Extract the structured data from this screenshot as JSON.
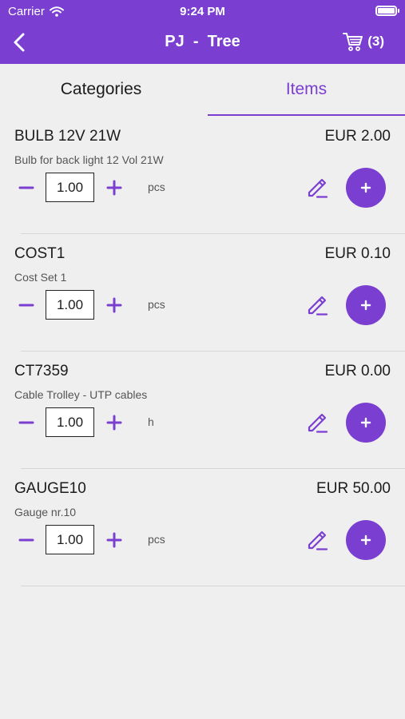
{
  "status_bar": {
    "carrier": "Carrier",
    "time": "9:24 PM"
  },
  "nav": {
    "title": "PJ  -  Tree",
    "cart_count": "(3)"
  },
  "tabs": [
    {
      "label": "Categories",
      "selected": false
    },
    {
      "label": "Items",
      "selected": true
    }
  ],
  "items": [
    {
      "code": "BULB 12V 21W",
      "description": "Bulb for back light 12 Vol 21W",
      "price": "EUR  2.00",
      "quantity": "1.00",
      "unit": "pcs"
    },
    {
      "code": "COST1",
      "description": "Cost Set 1",
      "price": "EUR  0.10",
      "quantity": "1.00",
      "unit": "pcs"
    },
    {
      "code": "CT7359",
      "description": "Cable Trolley - UTP cables",
      "price": "EUR  0.00",
      "quantity": "1.00",
      "unit": "h"
    },
    {
      "code": "GAUGE10",
      "description": "Gauge nr.10",
      "price": "EUR  50.00",
      "quantity": "1.00",
      "unit": "pcs"
    }
  ],
  "colors": {
    "accent": "#7a3fd1",
    "background": "#efefef"
  }
}
